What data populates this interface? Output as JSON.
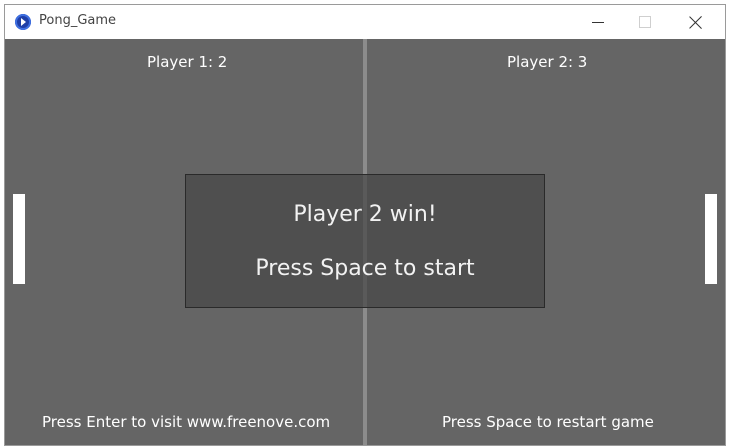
{
  "window": {
    "title": "Pong_Game",
    "icon": "app-icon",
    "controls": [
      "minimize-icon",
      "maximize-icon",
      "close-icon"
    ]
  },
  "game": {
    "background_color": "#656565",
    "center_line_color": "#8c8c8c",
    "paddle_color": "#ffffff",
    "scores": {
      "player1": "Player 1: 2",
      "player2": "Player 2: 3"
    },
    "message": {
      "winner": "Player 2 win!",
      "prompt": "Press Space to start"
    },
    "footer": {
      "left": "Press Enter to visit www.freenove.com",
      "right": "Press Space to restart game"
    }
  }
}
